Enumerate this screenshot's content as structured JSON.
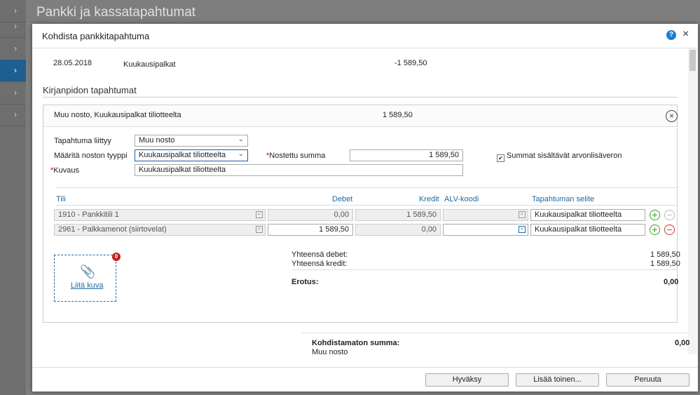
{
  "background": {
    "title": "Pankki ja kassatapahtumat",
    "sidebar_chevrons": [
      "›",
      "›",
      "›",
      "›",
      "›",
      "›"
    ]
  },
  "modal": {
    "title": "Kohdista pankkitapahtuma",
    "help": "?",
    "close": "×",
    "transaction": {
      "date": "28.05.2018",
      "description": "Kuukausipalkat",
      "amount": "-1 589,50"
    },
    "section_title": "Kirjanpidon tapahtumat",
    "entry": {
      "header_text": "Muu nosto, Kuukausipalkat tiliotteelta",
      "header_amount": "1 589,50",
      "type_label": "Tapahtuma liittyy",
      "type_value": "Muu nosto",
      "withdraw_type_label": "Määritä noston tyyppi",
      "withdraw_type_value": "Kuukausipalkat tiliotteelta",
      "withdrawn_label": "Nostettu summa",
      "withdrawn_value": "1 589,50",
      "vat_checkbox_label": "Summat sisältävät arvonlisäveron",
      "description_label": "Kuvaus",
      "description_value": "Kuukausipalkat tiliotteelta"
    },
    "table": {
      "headers": {
        "account": "Tili",
        "debit": "Debet",
        "credit": "Kredit",
        "vat": "ALV-koodi",
        "desc": "Tapahtuman selite"
      },
      "rows": [
        {
          "account": "1910 - Pankkitili 1",
          "debit": "0,00",
          "credit": "1 589,50",
          "vat": "",
          "desc": "Kuukausipalkat tiliotteelta"
        },
        {
          "account": "2961 - Palkkamenot (siirtovelat)",
          "debit": "1 589,50",
          "credit": "0,00",
          "vat": "",
          "desc": "Kuukausipalkat tiliotteelta"
        }
      ]
    },
    "attachment": {
      "count": "0",
      "link": "Liitä kuva"
    },
    "totals": {
      "debit_label": "Yhteensä debet:",
      "debit_value": "1 589,50",
      "credit_label": "Yhteensä kredit:",
      "credit_value": "1 589,50",
      "diff_label": "Erotus:",
      "diff_value": "0,00"
    },
    "unallocated": {
      "label": "Kohdistamaton summa:",
      "value": "0,00",
      "sub": "Muu nosto"
    },
    "buttons": {
      "accept": "Hyväksy",
      "add": "Lisää toinen...",
      "cancel": "Peruuta"
    }
  }
}
